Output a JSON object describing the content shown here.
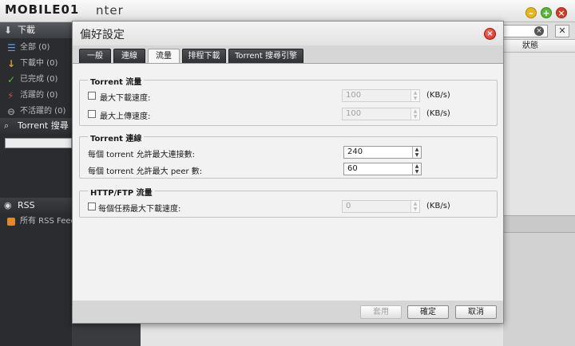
{
  "app": {
    "logo": "MOBILE01",
    "title_suffix": "nter",
    "window_controls": {
      "minimize": "–",
      "maximize": "+",
      "close": "×"
    }
  },
  "sidebar": {
    "downloads_header": "下載",
    "items": [
      {
        "label": "全部 (0)",
        "icon": "list-icon",
        "color": "#5aa0e6"
      },
      {
        "label": "下載中 (0)",
        "icon": "download-arrow-icon",
        "color": "#e39a2a"
      },
      {
        "label": "已完成 (0)",
        "icon": "check-icon",
        "color": "#5cbf3a"
      },
      {
        "label": "活躍的 (0)",
        "icon": "active-icon",
        "color": "#d64a3a"
      },
      {
        "label": "不活躍的 (0)",
        "icon": "inactive-icon",
        "color": "#9a9a9a"
      }
    ],
    "search_header": "Torrent 搜尋",
    "rss_header": "RSS",
    "rss_item": "所有 RSS Feeds"
  },
  "right_panel": {
    "status_column": "狀態",
    "clear_icon": "×",
    "close_icon": "✕"
  },
  "dialog": {
    "title": "偏好設定",
    "close_glyph": "×",
    "tabs": [
      {
        "label": "一般",
        "active": false
      },
      {
        "label": "連線",
        "active": false
      },
      {
        "label": "流量",
        "active": true
      },
      {
        "label": "排程下載",
        "active": false
      },
      {
        "label": "Torrent 搜尋引擎",
        "active": false
      }
    ],
    "groups": {
      "torrent_traffic": {
        "title": "Torrent 流量",
        "max_download": {
          "label": "最大下載速度:",
          "value": "100",
          "unit": "(KB/s)",
          "checked": false
        },
        "max_upload": {
          "label": "最大上傳速度:",
          "value": "100",
          "unit": "(KB/s)",
          "checked": false
        }
      },
      "torrent_connection": {
        "title": "Torrent 連線",
        "max_connections": {
          "label": "每個 torrent 允許最大連接數:",
          "value": "240"
        },
        "max_peers": {
          "label": "每個 torrent 允許最大 peer 數:",
          "value": "60"
        }
      },
      "http_ftp": {
        "title": "HTTP/FTP 流量",
        "max_task_download": {
          "label": "每個任務最大下載速度:",
          "value": "0",
          "unit": "(KB/s)",
          "checked": false
        }
      }
    },
    "buttons": {
      "apply": "套用",
      "ok": "確定",
      "cancel": "取消"
    }
  }
}
